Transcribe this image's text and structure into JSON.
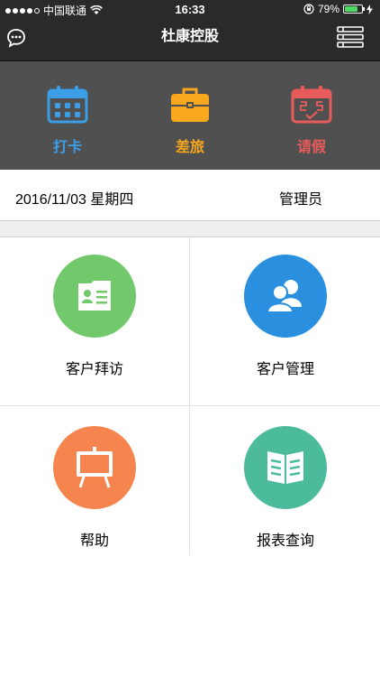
{
  "status_bar": {
    "carrier": "中国联通",
    "time": "16:33",
    "battery": "79%",
    "battery_level": 0.79
  },
  "nav": {
    "title": "杜康控股",
    "left_icon": "chat-bubble-icon",
    "right_icon": "list-menu-icon"
  },
  "quick_actions": [
    {
      "label": "打卡",
      "icon": "calendar-grid-icon",
      "color": "#3b9ee6"
    },
    {
      "label": "差旅",
      "icon": "briefcase-icon",
      "color": "#f7a81e"
    },
    {
      "label": "请假",
      "icon": "calendar-check-icon",
      "color": "#e85b5b"
    }
  ],
  "info": {
    "date": "2016/11/03 星期四",
    "user": "管理员"
  },
  "menu": [
    {
      "label": "客户拜访",
      "icon": "contact-card-icon",
      "color": "#72c96b"
    },
    {
      "label": "客户管理",
      "icon": "users-icon",
      "color": "#2a8fde"
    },
    {
      "label": "帮助",
      "icon": "easel-board-icon",
      "color": "#f5844f"
    },
    {
      "label": "报表查询",
      "icon": "open-book-icon",
      "color": "#4cbb9c"
    }
  ]
}
